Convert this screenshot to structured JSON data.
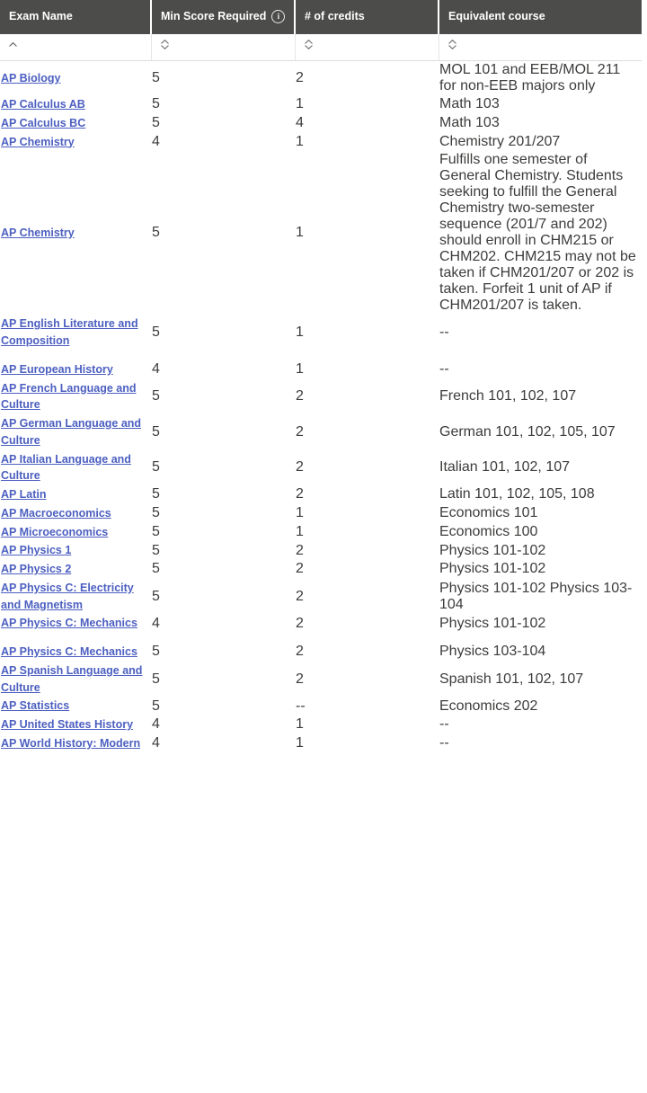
{
  "table": {
    "columns": [
      {
        "id": "exam_name",
        "label": "Exam Name",
        "has_info_icon": false,
        "sort_state": "ascending",
        "sort_icon": "chevron-up-icon"
      },
      {
        "id": "min_score",
        "label": "Min Score Required",
        "has_info_icon": true,
        "info_icon": "info-circle-icon",
        "sort_state": "none",
        "sort_icon": "sort-updown-icon"
      },
      {
        "id": "credits",
        "label": "# of credits",
        "has_info_icon": false,
        "sort_state": "none",
        "sort_icon": "sort-updown-icon"
      },
      {
        "id": "equivalent_course",
        "label": "Equivalent course",
        "has_info_icon": false,
        "sort_state": "none",
        "sort_icon": "sort-updown-icon"
      }
    ],
    "groups": [
      {
        "rows": [
          {
            "exam_name": "AP Biology",
            "min_score": "5",
            "credits": "2",
            "equivalent_course": "MOL 101 and EEB/MOL 211 for non-EEB majors only"
          },
          {
            "exam_name": "AP Calculus AB",
            "min_score": "5",
            "credits": "1",
            "equivalent_course": "Math 103"
          },
          {
            "exam_name": "AP Calculus BC",
            "min_score": "5",
            "credits": "4",
            "equivalent_course": "Math 103"
          },
          {
            "exam_name": "AP Chemistry",
            "min_score": "4",
            "credits": "1",
            "equivalent_course": "Chemistry 201/207"
          },
          {
            "exam_name": "AP Chemistry",
            "min_score": "5",
            "credits": "1",
            "equivalent_course": "Fulfills one semester of General Chemistry. Students seeking to fulfill the General Chemistry two-semester sequence (201/7 and 202) should enroll in CHM215 or CHM202. CHM215 may not be taken if CHM201/207 or 202 is taken. Forfeit 1 unit of AP if CHM201/207 is taken."
          },
          {
            "exam_name": "AP English Literature and Composition",
            "min_score": "5",
            "credits": "1",
            "equivalent_course": "--"
          }
        ]
      },
      {
        "rows": [
          {
            "exam_name": "AP European History",
            "min_score": "4",
            "credits": "1",
            "equivalent_course": "--"
          },
          {
            "exam_name": "AP French Language and Culture",
            "min_score": "5",
            "credits": "2",
            "equivalent_course": "French 101, 102, 107"
          },
          {
            "exam_name": "AP German Language and Culture",
            "min_score": "5",
            "credits": "2",
            "equivalent_course": "German 101, 102, 105, 107"
          },
          {
            "exam_name": "AP Italian Language and Culture",
            "min_score": "5",
            "credits": "2",
            "equivalent_course": "Italian 101, 102, 107"
          },
          {
            "exam_name": "AP Latin",
            "min_score": "5",
            "credits": "2",
            "equivalent_course": "Latin 101, 102, 105, 108"
          },
          {
            "exam_name": "AP Macroeconomics",
            "min_score": "5",
            "credits": "1",
            "equivalent_course": "Economics 101"
          },
          {
            "exam_name": "AP Microeconomics",
            "min_score": "5",
            "credits": "1",
            "equivalent_course": "Economics 100"
          },
          {
            "exam_name": "AP Physics 1",
            "min_score": "5",
            "credits": "2",
            "equivalent_course": "Physics 101-102"
          },
          {
            "exam_name": "AP Physics 2",
            "min_score": "5",
            "credits": "2",
            "equivalent_course": "Physics 101-102"
          },
          {
            "exam_name": "AP Physics C: Electricity and Magnetism",
            "min_score": "5",
            "credits": "2",
            "equivalent_course": "Physics 101-102 Physics 103-104"
          },
          {
            "exam_name": "AP Physics C: Mechanics",
            "min_score": "4",
            "credits": "2",
            "equivalent_course": "Physics 101-102"
          }
        ]
      },
      {
        "rows": [
          {
            "exam_name": "AP Physics C: Mechanics",
            "min_score": "5",
            "credits": "2",
            "equivalent_course": "Physics 103-104"
          },
          {
            "exam_name": "AP Spanish Language and Culture",
            "min_score": "5",
            "credits": "2",
            "equivalent_course": "Spanish 101, 102, 107"
          },
          {
            "exam_name": "AP Statistics",
            "min_score": "5",
            "credits": "--",
            "equivalent_course": "Economics 202"
          },
          {
            "exam_name": "AP United States History",
            "min_score": "4",
            "credits": "1",
            "equivalent_course": "--"
          },
          {
            "exam_name": "AP World History: Modern",
            "min_score": "4",
            "credits": "1",
            "equivalent_course": "--"
          }
        ]
      }
    ]
  },
  "colors": {
    "header_background": "#4c4c4a",
    "header_text": "#ffffff",
    "link": "#4c5fc0",
    "body_text": "#3d3d3c",
    "border": "#e4e4e4",
    "page_background": "#ffffff"
  }
}
